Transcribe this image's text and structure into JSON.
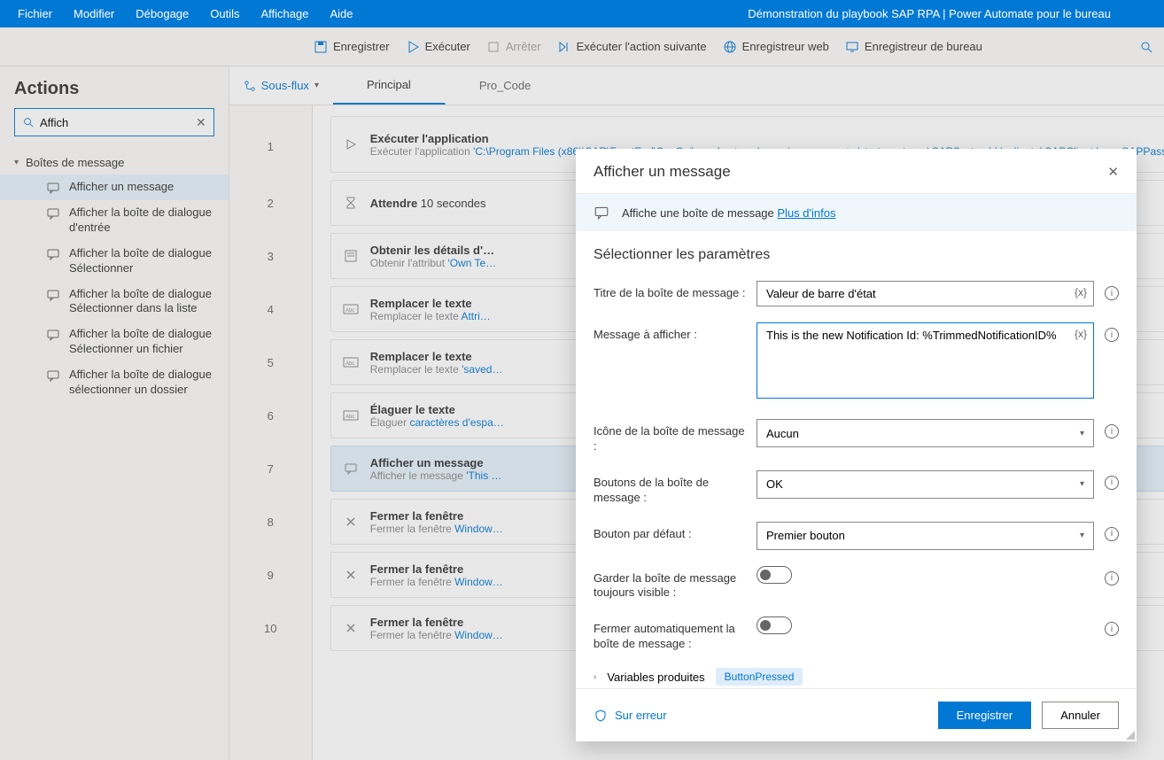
{
  "menubar": {
    "items": [
      "Fichier",
      "Modifier",
      "Débogage",
      "Outils",
      "Affichage",
      "Aide"
    ],
    "title": "Démonstration du playbook SAP RPA | Power Automate pour le bureau"
  },
  "toolbar": {
    "save": "Enregistrer",
    "run": "Exécuter",
    "stop": "Arrêter",
    "next": "Exécuter l'action suivante",
    "webrec": "Enregistreur web",
    "deskrec": "Enregistreur de bureau"
  },
  "sidebar": {
    "heading": "Actions",
    "search_value": "Affich",
    "group": "Boîtes de message",
    "items": [
      "Afficher un message",
      "Afficher la boîte de dialogue d'entrée",
      "Afficher la boîte de dialogue Sélectionner",
      "Afficher la boîte de dialogue Sélectionner dans la liste",
      "Afficher la boîte de dialogue Sélectionner un fichier",
      "Afficher la boîte de dialogue sélectionner un dossier"
    ]
  },
  "subflow": {
    "label": "Sous-flux",
    "tabs": [
      "Principal",
      "Pro_Code"
    ]
  },
  "steps": [
    {
      "n": "1",
      "title": "Exécuter l'application",
      "desc_pre": "Exécuter l'application ",
      "path": "'C:\\Program Files (x86)\\SAR\\FrontEnd\\SapGui\\sapshcut.exe'",
      "desc_mid": " avec les arguments ",
      "args": "'start -system='  SAPSystemId  ' -client='  SAPClient  '-use   SAPPassword  ' -n",
      "icon": "play"
    },
    {
      "n": "2",
      "title": "Attendre",
      "desc_pre": "",
      "path": "10",
      "desc_mid": " secondes",
      "args": "",
      "icon": "hourglass",
      "inline": true
    },
    {
      "n": "3",
      "title": "Obtenir les détails d'…",
      "desc_pre": "Obtenir l'attribut ",
      "path": "'Own Te…",
      "desc_mid": "",
      "args": "",
      "icon": "form"
    },
    {
      "n": "4",
      "title": "Remplacer le texte",
      "desc_pre": "Remplacer le texte   ",
      "path": "Attri…",
      "desc_mid": "",
      "args": "",
      "icon": "abc"
    },
    {
      "n": "5",
      "title": "Remplacer le texte",
      "desc_pre": "Remplacer le texte ",
      "path": "'saved…",
      "desc_mid": "",
      "args": "",
      "icon": "abc"
    },
    {
      "n": "6",
      "title": "Élaguer le texte",
      "desc_pre": "Élaguer ",
      "path": "caractères d'espa…",
      "desc_mid": "",
      "args": "",
      "icon": "abc"
    },
    {
      "n": "7",
      "title": "Afficher un message",
      "desc_pre": "Afficher le message ",
      "path": "'This …",
      "desc_mid": "",
      "args": "",
      "icon": "msg",
      "selected": true
    },
    {
      "n": "8",
      "title": "Fermer la fenêtre",
      "desc_pre": "Fermer la fenêtre ",
      "path": "Window…",
      "desc_mid": "",
      "args": "",
      "icon": "x"
    },
    {
      "n": "9",
      "title": "Fermer la fenêtre",
      "desc_pre": "Fermer la fenêtre ",
      "path": "Window…",
      "desc_mid": "",
      "args": "",
      "icon": "x"
    },
    {
      "n": "10",
      "title": "Fermer la fenêtre",
      "desc_pre": "Fermer la fenêtre ",
      "path": "Window…",
      "desc_mid": "",
      "args": "",
      "icon": "x"
    }
  ],
  "modal": {
    "title": "Afficher un message",
    "info_text": "Affiche une boîte de message ",
    "info_link": "Plus d'infos",
    "section": "Sélectionner les paramètres",
    "fields": {
      "title_label": "Titre de la boîte de message :",
      "title_value": "Valeur de barre d'état",
      "message_label": "Message à afficher :",
      "message_value": "This is the new Notification Id: %TrimmedNotificationID%",
      "icon_label": "Icône de la boîte de message :",
      "icon_value": "Aucun",
      "buttons_label": "Boutons de la boîte de message :",
      "buttons_value": "OK",
      "default_label": "Bouton par défaut :",
      "default_value": "Premier bouton",
      "ontop_label": "Garder la boîte de message toujours visible :",
      "autoclose_label": "Fermer automatiquement la boîte de message :"
    },
    "vars_label": "Variables produites",
    "vars_pill": "ButtonPressed",
    "onerror": "Sur erreur",
    "save": "Enregistrer",
    "cancel": "Annuler"
  }
}
